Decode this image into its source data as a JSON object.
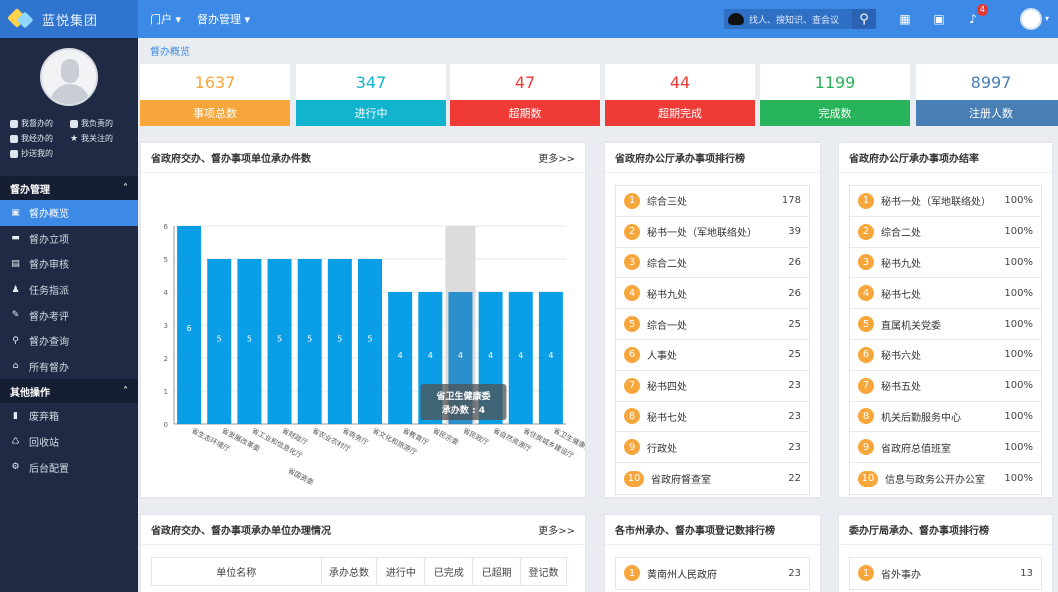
{
  "app": {
    "name": "蓝悦集团"
  },
  "topnav": [
    {
      "label": "门户 ▾"
    },
    {
      "label": "督办管理 ▾"
    }
  ],
  "search": {
    "placeholder": "找人、搜知识、查会议"
  },
  "notifications": {
    "count": "4"
  },
  "sidebar": {
    "quick_links": [
      {
        "label": "我督办的",
        "icon": "person-icon"
      },
      {
        "label": "我负责的",
        "icon": "document-icon"
      },
      {
        "label": "我经办的",
        "icon": "person-icon"
      },
      {
        "label": "我关注的",
        "icon": "star-icon"
      },
      {
        "label": "抄送我的",
        "icon": "copy-icon"
      }
    ],
    "sections": [
      {
        "title": "督办管理",
        "items": [
          {
            "label": "督办概览",
            "icon": "camera-icon",
            "active": true
          },
          {
            "label": "督办立项",
            "icon": "keyboard-icon"
          },
          {
            "label": "督办审核",
            "icon": "audit-icon"
          },
          {
            "label": "任务指派",
            "icon": "assign-icon"
          },
          {
            "label": "督办考评",
            "icon": "edit-icon"
          },
          {
            "label": "督办查询",
            "icon": "search-icon"
          },
          {
            "label": "所有督办",
            "icon": "home-icon"
          }
        ]
      },
      {
        "title": "其他操作",
        "items": [
          {
            "label": "废弃箱",
            "icon": "trash-icon"
          },
          {
            "label": "回收站",
            "icon": "recycle-icon"
          },
          {
            "label": "后台配置",
            "icon": "gear-icon"
          }
        ]
      }
    ]
  },
  "breadcrumb": "督办概览",
  "stats": [
    {
      "value": "1637",
      "label": "事项总数",
      "color": "#f7a63b"
    },
    {
      "value": "347",
      "label": "进行中",
      "color": "#12b3cc"
    },
    {
      "value": "47",
      "label": "超期数",
      "color": "#ef3a36"
    },
    {
      "value": "44",
      "label": "超期完成",
      "color": "#ef3a36"
    },
    {
      "value": "1199",
      "label": "完成数",
      "color": "#27b35a"
    },
    {
      "value": "8997",
      "label": "注册人数",
      "color": "#4a7fb5"
    }
  ],
  "chart_panel": {
    "title": "省政府交办、督办事项单位承办件数",
    "more": "更多>>"
  },
  "chart_data": {
    "type": "bar",
    "title": "省政府交办、督办事项单位承办件数",
    "categories": [
      "省生态环境厅",
      "省发展改革委",
      "省工业和信息化厅",
      "省财政厅",
      "省农业农村厅",
      "省商务厅",
      "省文化和旅游厅",
      "省教育厅",
      "省民宗委",
      "省民政厅",
      "省自然资源厅",
      "省住房城乡建设厅",
      "省卫生健康委"
    ],
    "values": [
      6,
      5,
      5,
      5,
      5,
      5,
      5,
      4,
      4,
      4,
      4,
      4,
      4
    ],
    "ylim": [
      0,
      6
    ],
    "yticks": [
      "0",
      "1",
      "2",
      "3",
      "4",
      "5",
      "6"
    ],
    "extra_label": "省国资委",
    "bar_color": "#0a9ee6",
    "highlight_index": 9,
    "tooltip": {
      "title": "省卫生健康委",
      "line": "承办数 : 4"
    }
  },
  "rank1": {
    "title": "省政府办公厅承办事项排行榜",
    "items": [
      {
        "rank": "1",
        "name": "综合三处",
        "value": "178"
      },
      {
        "rank": "2",
        "name": "秘书一处（军地联络处）",
        "value": "39"
      },
      {
        "rank": "3",
        "name": "综合二处",
        "value": "26"
      },
      {
        "rank": "4",
        "name": "秘书九处",
        "value": "26"
      },
      {
        "rank": "5",
        "name": "综合一处",
        "value": "25"
      },
      {
        "rank": "6",
        "name": "人事处",
        "value": "25"
      },
      {
        "rank": "7",
        "name": "秘书四处",
        "value": "23"
      },
      {
        "rank": "8",
        "name": "秘书七处",
        "value": "23"
      },
      {
        "rank": "9",
        "name": "行政处",
        "value": "23"
      },
      {
        "rank": "10",
        "name": "省政府督查室",
        "value": "22"
      }
    ]
  },
  "rank2": {
    "title": "省政府办公厅承办事项办结率",
    "items": [
      {
        "rank": "1",
        "name": "秘书一处（军地联络处）",
        "value": "100%"
      },
      {
        "rank": "2",
        "name": "综合二处",
        "value": "100%"
      },
      {
        "rank": "3",
        "name": "秘书九处",
        "value": "100%"
      },
      {
        "rank": "4",
        "name": "秘书七处",
        "value": "100%"
      },
      {
        "rank": "5",
        "name": "直属机关党委",
        "value": "100%"
      },
      {
        "rank": "6",
        "name": "秘书六处",
        "value": "100%"
      },
      {
        "rank": "7",
        "name": "秘书五处",
        "value": "100%"
      },
      {
        "rank": "8",
        "name": "机关后勤服务中心",
        "value": "100%"
      },
      {
        "rank": "9",
        "name": "省政府总值班室",
        "value": "100%"
      },
      {
        "rank": "10",
        "name": "信息与政务公开办公室",
        "value": "100%"
      }
    ]
  },
  "table_panel": {
    "title": "省政府交办、督办事项承办单位办理情况",
    "more": "更多>>",
    "columns": [
      "单位名称",
      "承办总数",
      "进行中",
      "已完成",
      "已超期",
      "登记数"
    ]
  },
  "city_panel": {
    "title": "各市州承办、督办事项登记数排行榜",
    "items": [
      {
        "rank": "1",
        "name": "黄南州人民政府",
        "value": "23"
      }
    ]
  },
  "bureau_panel": {
    "title": "委办厅局承办、督办事项排行榜",
    "items": [
      {
        "rank": "1",
        "name": "省外事办",
        "value": "13"
      }
    ]
  }
}
